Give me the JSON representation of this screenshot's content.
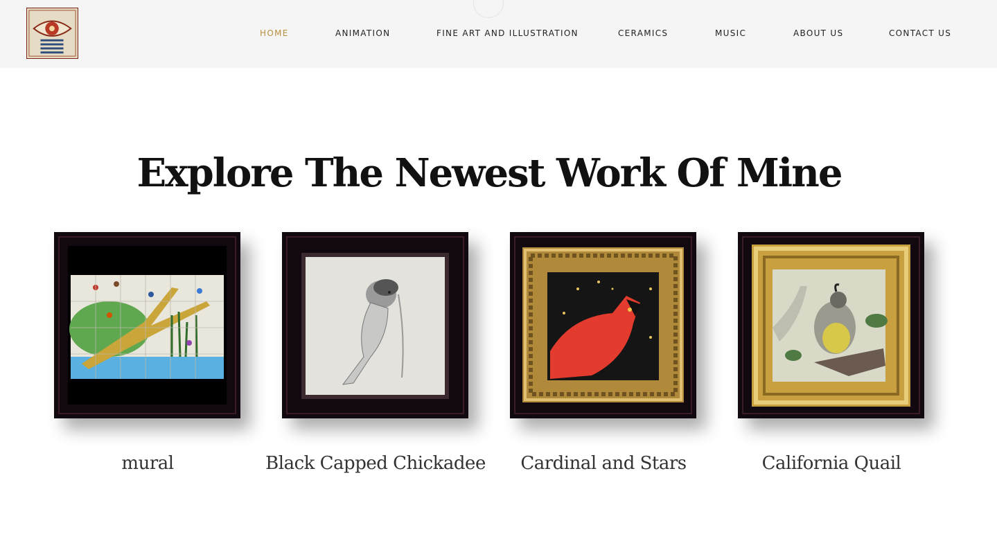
{
  "nav": {
    "items": [
      {
        "label": "HOME",
        "active": true
      },
      {
        "label": "ANIMATION"
      },
      {
        "label": "FINE ART AND ILLUSTRATION"
      },
      {
        "label": "CERAMICS"
      },
      {
        "label": "MUSIC"
      },
      {
        "label": "ABOUT US"
      },
      {
        "label": "CONTACT US"
      }
    ],
    "active_color": "#b8903a"
  },
  "main": {
    "title": "Explore The Newest Work Of Mine"
  },
  "works": [
    {
      "title": "mural"
    },
    {
      "title": "Black Capped Chickadee"
    },
    {
      "title": "Cardinal and Stars"
    },
    {
      "title": "California Quail"
    }
  ]
}
